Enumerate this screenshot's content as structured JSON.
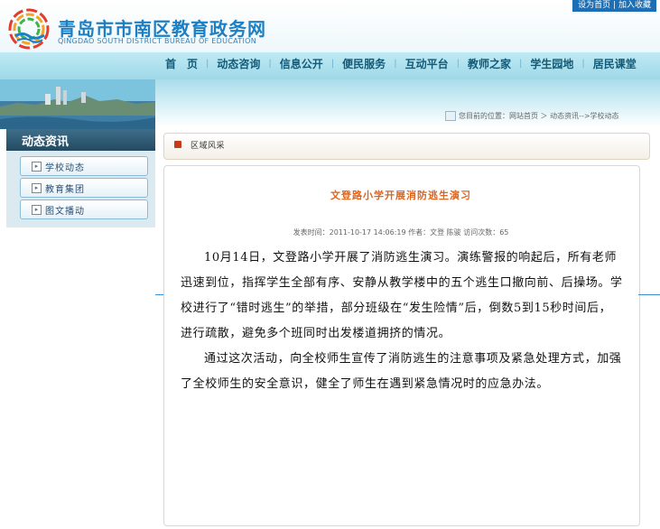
{
  "header": {
    "top_links": [
      "设为首页",
      "加入收藏"
    ],
    "top_sep": "|",
    "title": "青岛市市南区教育政务网",
    "subtitle": "QINGDAO SOUTH DISTRICT BUREAU OF EDUCATION"
  },
  "nav": {
    "items": [
      {
        "label": "首　页"
      },
      {
        "label": "动态咨询"
      },
      {
        "label": "信息公开"
      },
      {
        "label": "便民服务"
      },
      {
        "label": "互动平台"
      },
      {
        "label": "教师之家"
      },
      {
        "label": "学生园地"
      },
      {
        "label": "居民课堂"
      }
    ]
  },
  "sidebar": {
    "title": "动态资讯",
    "items": [
      {
        "label": "学校动态"
      },
      {
        "label": "教育集团"
      },
      {
        "label": "图文播动"
      }
    ]
  },
  "breadcrumb": "您目前的位置：网站首页 ＞ 动态资讯-->学校动态",
  "section": {
    "title": "区域风采"
  },
  "article": {
    "title": "文登路小学开展消防逃生演习",
    "meta": "发表时间：2011-10-17 14:06:19  作者：文登 陈骏  访问次数：65",
    "paragraphs": [
      "10月14日，文登路小学开展了消防逃生演习。演练警报的响起后，所有老师迅速到位，指挥学生全部有序、安静从教学楼中的五个逃生口撤向前、后操场。学校进行了“错时逃生”的举措，部分班级在“发生险情”后，倒数5到15秒时间后，进行疏散，避免多个班同时出发楼道拥挤的情况。",
      "通过这次活动，向全校师生宣传了消防逃生的注意事项及紧急处理方式，加强了全校师生的安全意识，健全了师生在遇到紧急情况时的应急办法。"
    ]
  },
  "colors": {
    "title_blue": "#1c7fc3",
    "article_title_orange": "#e0641b",
    "sidebar_dark": "#244a61",
    "nav_bg": "#bfeaf4"
  }
}
